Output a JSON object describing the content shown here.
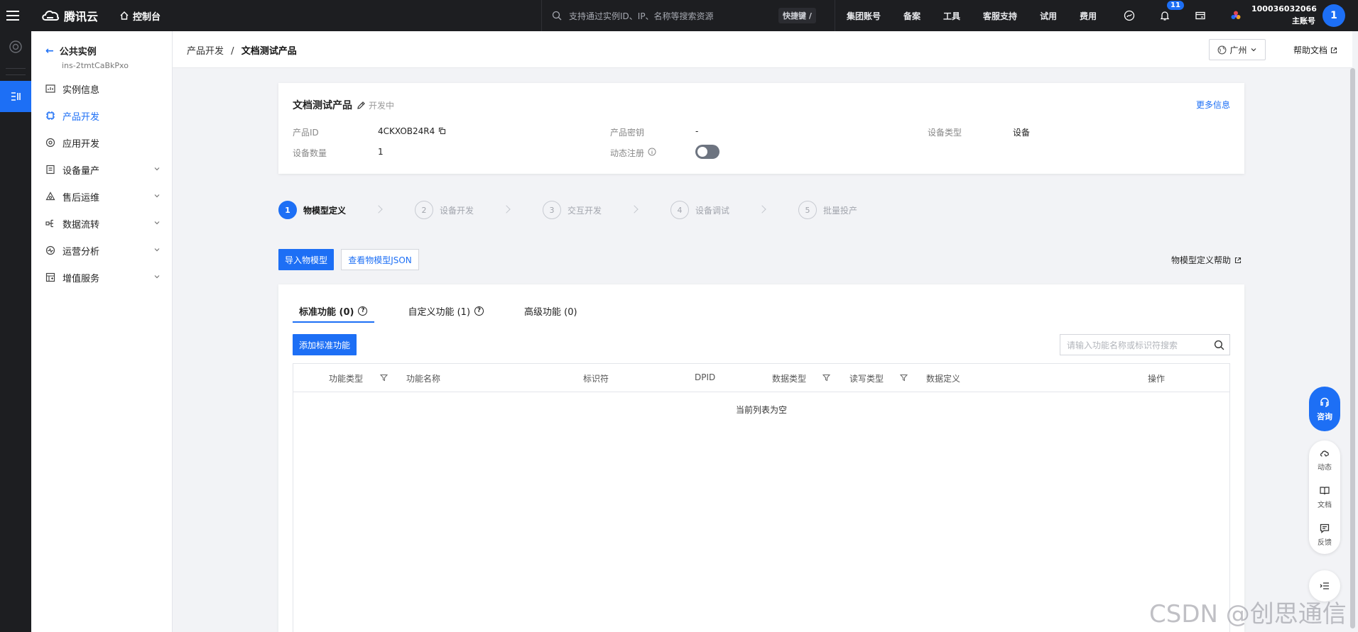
{
  "topbar": {
    "brand": "腾讯云",
    "console": "控制台",
    "search_placeholder": "支持通过实例ID、IP、名称等搜索资源",
    "shortcut": "快捷键 /",
    "nav": [
      "集团账号",
      "备案",
      "工具",
      "客服支持",
      "试用",
      "费用"
    ],
    "notification_count": "11",
    "account_id": "100036032066",
    "account_role": "主账号",
    "avatar": "1"
  },
  "sidebar": {
    "title": "公共实例",
    "subtitle": "ins-2tmtCaBkPxo",
    "items": [
      {
        "label": "实例信息",
        "icon": "instance-info-icon",
        "active": false,
        "expandable": false
      },
      {
        "label": "产品开发",
        "icon": "chip-icon",
        "active": true,
        "expandable": false
      },
      {
        "label": "应用开发",
        "icon": "app-dev-icon",
        "active": false,
        "expandable": false
      },
      {
        "label": "设备量产",
        "icon": "device-production-icon",
        "active": false,
        "expandable": true
      },
      {
        "label": "售后运维",
        "icon": "maintenance-icon",
        "active": false,
        "expandable": true
      },
      {
        "label": "数据流转",
        "icon": "data-flow-icon",
        "active": false,
        "expandable": true
      },
      {
        "label": "运营分析",
        "icon": "analytics-icon",
        "active": false,
        "expandable": true
      },
      {
        "label": "增值服务",
        "icon": "value-added-icon",
        "active": false,
        "expandable": true
      }
    ]
  },
  "header": {
    "breadcrumb_parent": "产品开发",
    "breadcrumb_sep": "/",
    "breadcrumb_current": "文档测试产品",
    "region": "广州",
    "help_doc": "帮助文档"
  },
  "product": {
    "name": "文档测试产品",
    "status": "开发中",
    "more_info": "更多信息",
    "fields": {
      "product_id_label": "产品ID",
      "product_id": "4CKXOB24R4",
      "product_secret_label": "产品密钥",
      "product_secret": "-",
      "device_type_label": "设备类型",
      "device_type": "设备",
      "device_count_label": "设备数量",
      "device_count": "1",
      "dynamic_reg_label": "动态注册",
      "dynamic_reg_enabled": false
    }
  },
  "steps": [
    {
      "num": "1",
      "label": "物模型定义",
      "active": true
    },
    {
      "num": "2",
      "label": "设备开发",
      "active": false
    },
    {
      "num": "3",
      "label": "交互开发",
      "active": false
    },
    {
      "num": "4",
      "label": "设备调试",
      "active": false
    },
    {
      "num": "5",
      "label": "批量投产",
      "active": false
    }
  ],
  "actions": {
    "import_model": "导入物模型",
    "view_json": "查看物模型JSON",
    "model_help": "物模型定义帮助"
  },
  "functions": {
    "tabs": [
      {
        "label": "标准功能 (0)",
        "help": true,
        "active": true
      },
      {
        "label": "自定义功能 (1)",
        "help": true,
        "active": false
      },
      {
        "label": "高级功能 (0)",
        "help": false,
        "active": false
      }
    ],
    "add_button": "添加标准功能",
    "search_placeholder": "请输入功能名称或标识符搜索",
    "columns": [
      "功能类型",
      "功能名称",
      "标识符",
      "DPID",
      "数据类型",
      "读写类型",
      "数据定义",
      "操作"
    ],
    "empty_text": "当前列表为空"
  },
  "float_tools": {
    "consult": "咨询",
    "items": [
      "动态",
      "文档",
      "反馈"
    ]
  },
  "watermark": "CSDN @创思通信",
  "colors": {
    "primary": "#1d6ff5",
    "topbar_bg": "#1d1e21",
    "page_bg": "#f2f3f6"
  }
}
